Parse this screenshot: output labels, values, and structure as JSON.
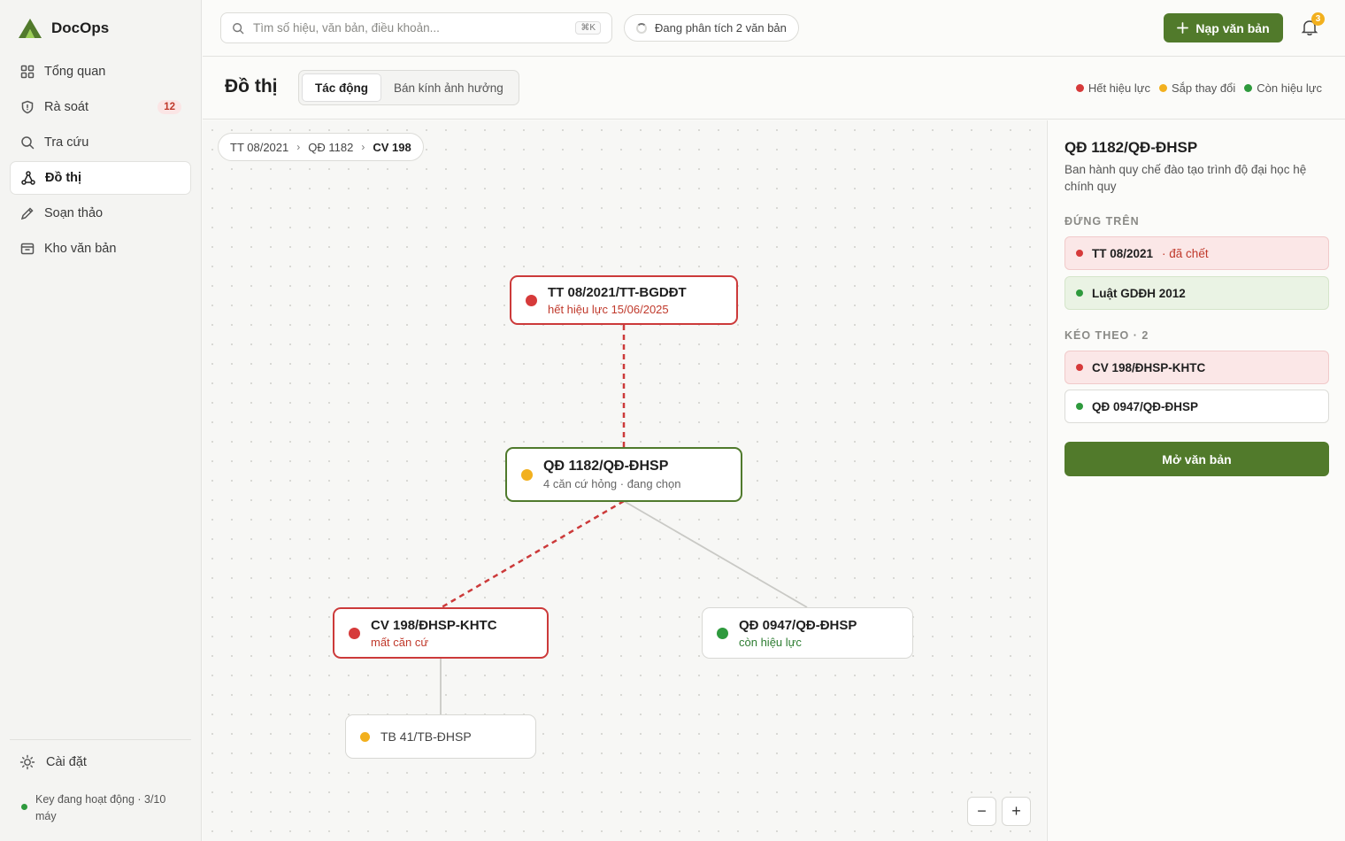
{
  "app": {
    "name": "DocOps"
  },
  "sidebar": {
    "items": [
      {
        "label": "Tổng quan",
        "icon": "grid-icon"
      },
      {
        "label": "Rà soát",
        "icon": "shield-icon",
        "badge": "12"
      },
      {
        "label": "Tra cứu",
        "icon": "search-icon"
      },
      {
        "label": "Đồ thị",
        "icon": "graph-icon",
        "active": true
      },
      {
        "label": "Soạn thảo",
        "icon": "pencil-icon"
      },
      {
        "label": "Kho văn bản",
        "icon": "archive-icon"
      }
    ],
    "settings_label": "Cài đặt",
    "key_status": "Key đang hoạt động · 3/10 máy"
  },
  "topbar": {
    "search_placeholder": "Tìm số hiệu, văn bản, điều khoản...",
    "search_shortcut": "⌘K",
    "analyzing_text": "Đang phân tích 2 văn bản",
    "import_label": "Nạp văn bản",
    "notifications_count": "3"
  },
  "page": {
    "title": "Đồ thị",
    "tabs": [
      {
        "label": "Tác động",
        "active": true
      },
      {
        "label": "Bán kính ảnh hưởng",
        "active": false
      }
    ],
    "legend": [
      {
        "label": "Hết hiệu lực",
        "color": "#d63a3a"
      },
      {
        "label": "Sắp thay đổi",
        "color": "#f2b01e"
      },
      {
        "label": "Còn hiệu lực",
        "color": "#2e9a3d"
      }
    ]
  },
  "graph": {
    "breadcrumb": [
      "TT 08/2021",
      "QĐ 1182",
      "CV 198"
    ],
    "nodes": {
      "tt08": {
        "title": "TT 08/2021/TT-BGDĐT",
        "subtitle": "hết hiệu lực 15/06/2025",
        "status": "expired"
      },
      "qd1182": {
        "title": "QĐ 1182/QĐ-ĐHSP",
        "subtitle": "4 căn cứ hỏng · đang chọn",
        "status": "changing"
      },
      "cv198": {
        "title": "CV 198/ĐHSP-KHTC",
        "subtitle": "mất căn cứ",
        "status": "expired"
      },
      "qd0947": {
        "title": "QĐ 0947/QĐ-ĐHSP",
        "subtitle": "còn hiệu lực",
        "status": "valid"
      },
      "tb41": {
        "title": "TB 41/TB-ĐHSP",
        "subtitle": "",
        "status": "changing"
      }
    },
    "zoom_out": "−",
    "zoom_in": "+"
  },
  "panel": {
    "title": "QĐ 1182/QĐ-ĐHSP",
    "description": "Ban hành quy chế đào tạo trình độ đại học hệ chính quy",
    "above_label": "ĐỨNG TRÊN",
    "above": [
      {
        "name": "TT 08/2021",
        "note": "· đã chết",
        "status": "expired"
      },
      {
        "name": "Luật GDĐH 2012",
        "note": "",
        "status": "valid"
      }
    ],
    "below_label": "KÉO THEO · 2",
    "below": [
      {
        "name": "CV 198/ĐHSP-KHTC",
        "status": "expired"
      },
      {
        "name": "QĐ 0947/QĐ-ĐHSP",
        "status": "valid"
      }
    ],
    "open_label": "Mở văn bản"
  },
  "colors": {
    "brand": "#517a2b",
    "expired": "#d63a3a",
    "changing": "#f2b01e",
    "valid": "#2e9a3d"
  }
}
